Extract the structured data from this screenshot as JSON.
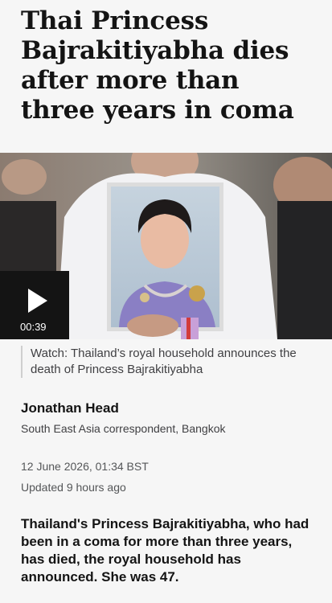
{
  "article": {
    "headline": "Thai Princess Bajrakitiyabha dies after more than three years in coma",
    "media": {
      "duration": "00:39",
      "play_icon": "play-icon",
      "caption": "Watch: Thailand’s royal household announces the death of Princess Bajrakitiyabha"
    },
    "byline": {
      "author": "Jonathan Head",
      "role": "South East Asia correspondent, Bangkok"
    },
    "timestamp": {
      "published": "12 June 2026, 01:34 BST",
      "updated": "Updated 9 hours ago"
    },
    "lead": "Thailand's Princess Bajrakitiyabha, who had been in a coma for more than three years, has died, the royal household has announced. She was 47."
  },
  "colors": {
    "background": "#f6f6f6",
    "text": "#141414",
    "secondary_text": "#3f3f42",
    "play_block": "#141414"
  }
}
